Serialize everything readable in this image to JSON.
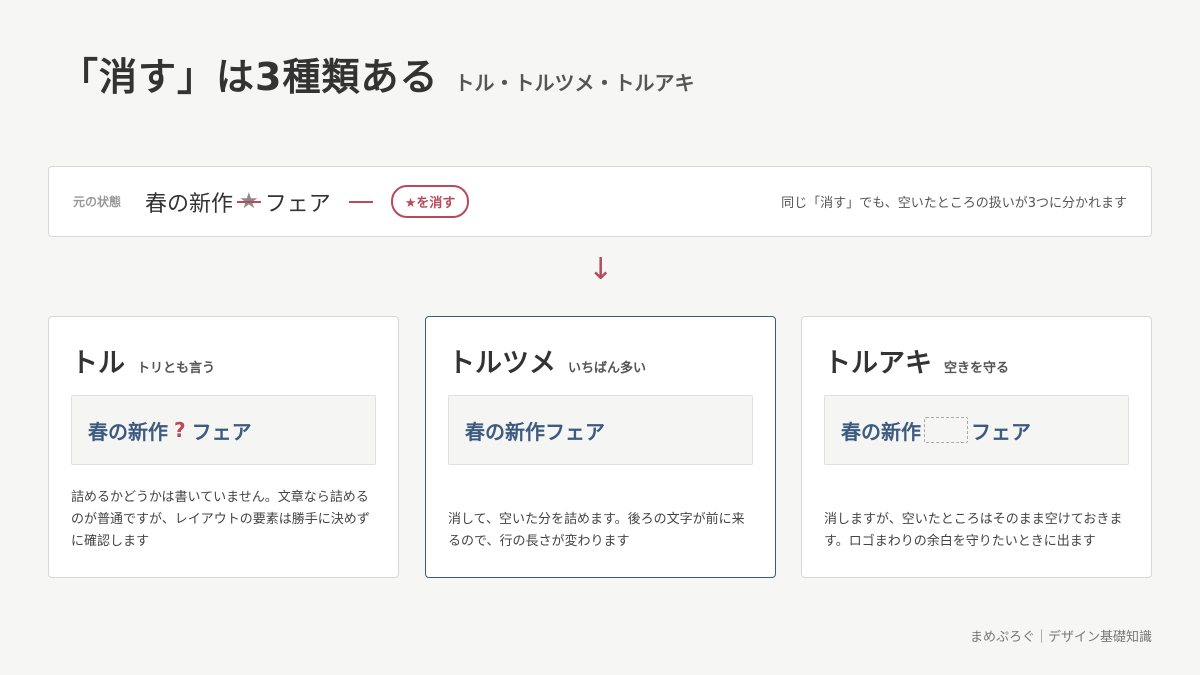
{
  "heading": {
    "main": "「消す」は3種類ある",
    "sub": "トル・トルツメ・トルアキ"
  },
  "origin": {
    "label": "元の状態",
    "text_before": "春の新作",
    "star": "★",
    "text_after": "フェア",
    "pill": "★を消す",
    "note": "同じ「消す」でも、空いたところの扱いが3つに分かれます"
  },
  "arrow": "↓",
  "cards": [
    {
      "title": "トル",
      "sub": "トリとも言う",
      "sample_before": "春の新作",
      "sample_mark": "?",
      "sample_after": "フェア",
      "desc": "詰めるかどうかは書いていません。文章なら詰めるのが普通ですが、レイアウトの要素は勝手に決めずに確認します"
    },
    {
      "title": "トルツメ",
      "sub": "いちばん多い",
      "sample": "春の新作フェア",
      "desc": "消して、空いた分を詰めます。後ろの文字が前に来るので、行の長さが変わります"
    },
    {
      "title": "トルアキ",
      "sub": "空きを守る",
      "sample_before": "春の新作",
      "sample_after": "フェア",
      "desc": "消しますが、空いたところはそのまま空けておきます。ロゴまわりの余白を守りたいときに出ます"
    }
  ],
  "footer": "まめぷろぐ｜デザイン基礎知識",
  "colors": {
    "accent": "#b94a5a",
    "navy": "#3d5a80",
    "background": "#f6f6f4"
  }
}
